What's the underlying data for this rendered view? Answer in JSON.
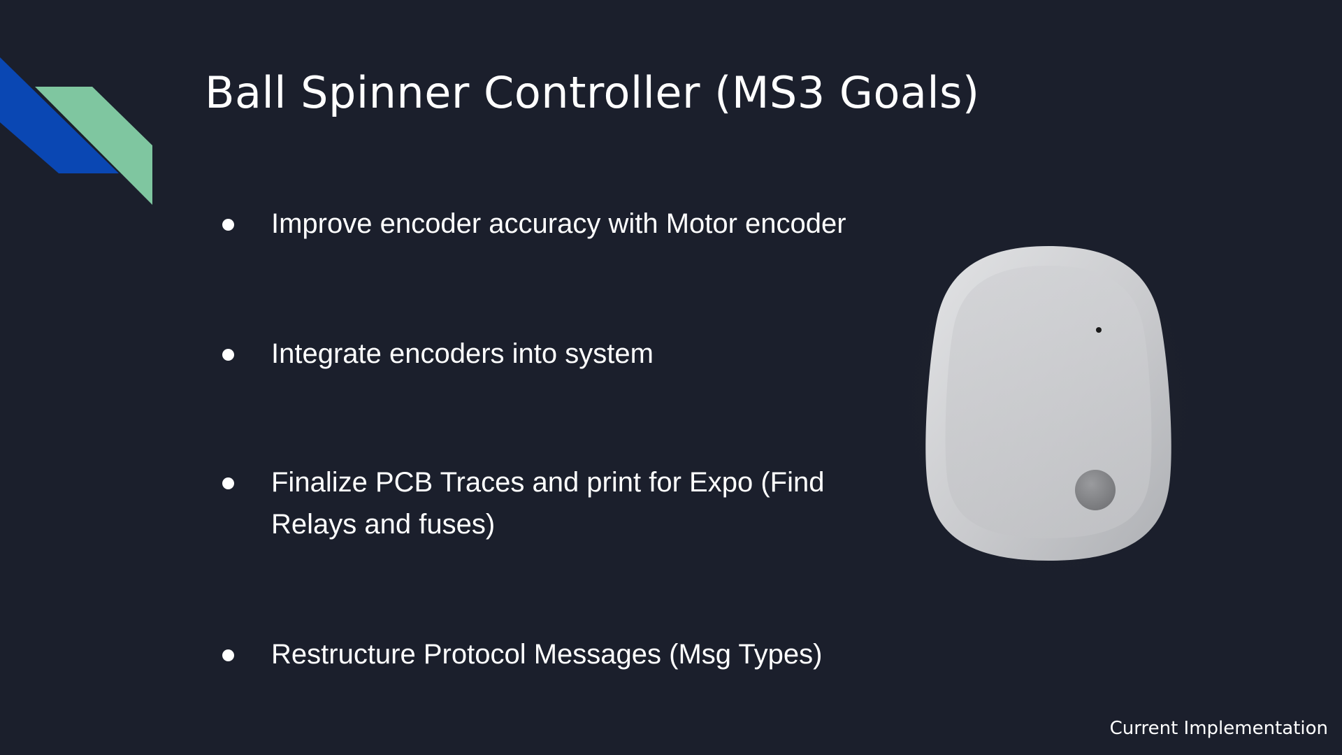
{
  "slide": {
    "title": "Ball Spinner Controller (MS3 Goals)",
    "bullets": [
      {
        "text": "Improve encoder accuracy with Motor encoder"
      },
      {
        "text": "Integrate encoders into system"
      },
      {
        "text": "Finalize PCB Traces and print for Expo (Find Relays and fuses)"
      },
      {
        "text": "Restructure Protocol Messages (Msg Types)"
      }
    ],
    "caption": "Current Implementation",
    "colors": {
      "background": "#1b1f2c",
      "accent_blue": "#0a47b3",
      "accent_green": "#7fc6a0",
      "text": "#ffffff"
    }
  }
}
